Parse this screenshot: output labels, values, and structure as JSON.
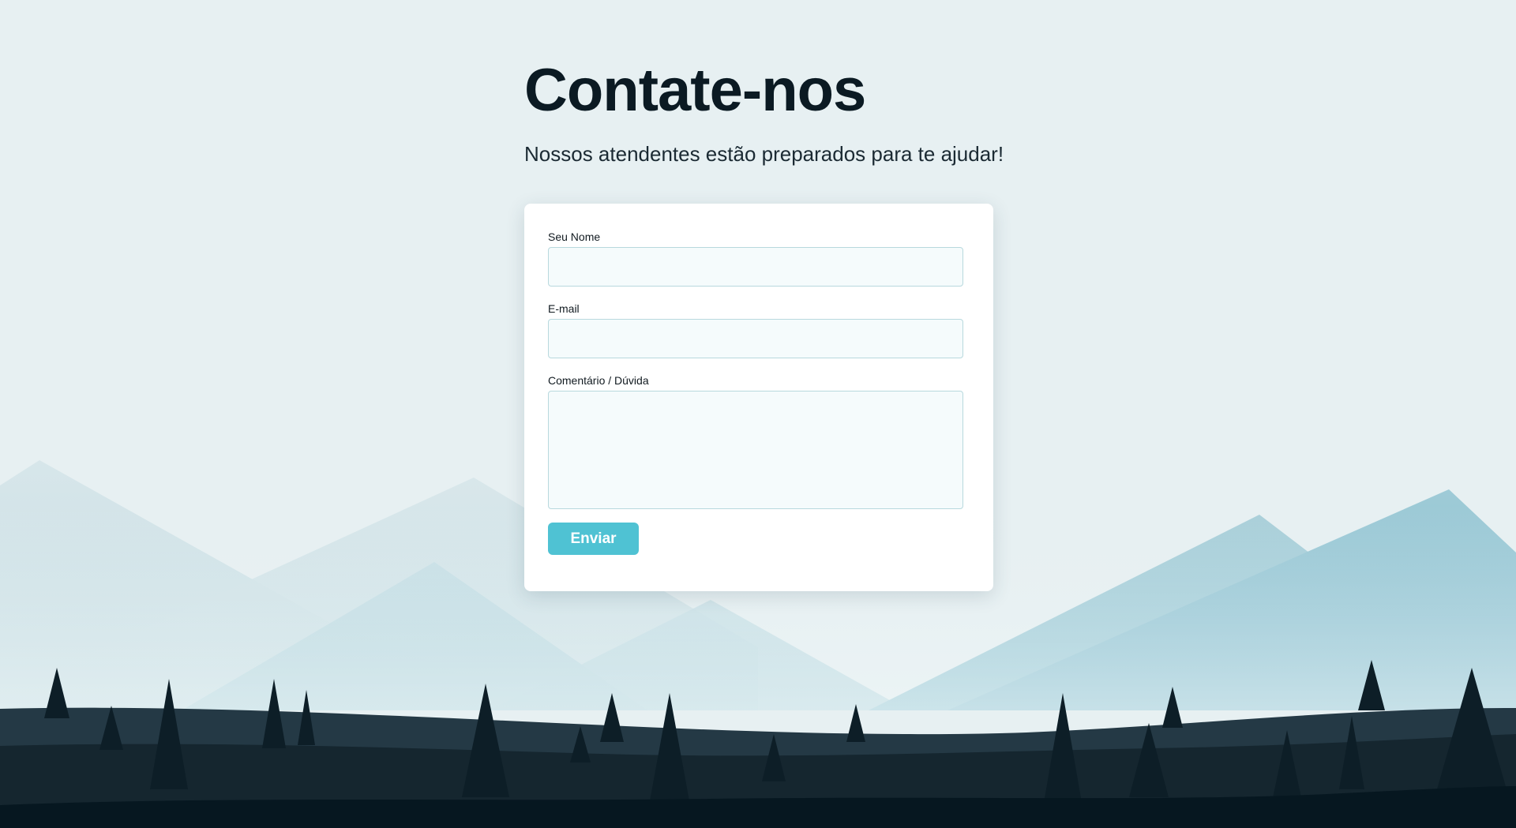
{
  "header": {
    "title": "Contate-nos",
    "subtitle": "Nossos atendentes estão preparados para te ajudar!"
  },
  "form": {
    "name_label": "Seu Nome",
    "name_value": "",
    "email_label": "E-mail",
    "email_value": "",
    "comment_label": "Comentário / Dúvida",
    "comment_value": "",
    "submit_label": "Enviar"
  },
  "colors": {
    "background": "#e7f0f2",
    "accent": "#4fc2d3",
    "title": "#0b1a23",
    "forest_dark": "#061720"
  },
  "icons": [
    "mountains-illustration",
    "pine-tree-icon"
  ]
}
